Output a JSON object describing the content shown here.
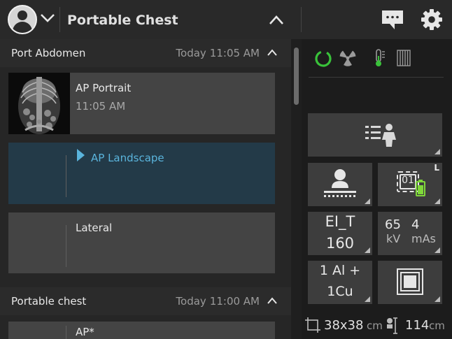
{
  "header": {
    "title": "Portable Chest",
    "icons": [
      "user-avatar-icon",
      "chevron-down-icon",
      "chevron-up-icon",
      "chat-icon",
      "gear-icon"
    ]
  },
  "studies": [
    {
      "name": "Port Abdomen",
      "date": "Today",
      "time": "11:05 AM",
      "series": [
        {
          "name": "AP Portrait",
          "time": "11:05 AM",
          "has_thumbnail": true
        },
        {
          "name": "AP  Landscape",
          "active": true
        },
        {
          "name": "Lateral"
        }
      ]
    },
    {
      "name": "Portable chest",
      "date": "Today",
      "time": "11:00 AM",
      "series": [
        {
          "name": "AP*"
        }
      ]
    }
  ],
  "panel": {
    "status_icons": [
      "ready-ring-icon",
      "radiation-icon",
      "thermometer-icon",
      "grid-icon"
    ],
    "detector_side": "L",
    "detector_id": "01",
    "exposure_index": {
      "label": "EI_T",
      "value": "160"
    },
    "technique": {
      "kv_value": "65",
      "kv_unit": "kV",
      "mas_value": "4",
      "mas_unit": "mAs"
    },
    "filter": {
      "line1": "1 Al +",
      "line2": "1Cu"
    },
    "field_size": {
      "value": "38x38",
      "unit": "cm"
    },
    "sid": {
      "value": "114",
      "unit": "cm"
    }
  },
  "colors": {
    "accent_blue": "#5ab4dc",
    "ready_green": "#39c23a",
    "battery_green": "#7fd83a",
    "active_row": "#233a48"
  }
}
